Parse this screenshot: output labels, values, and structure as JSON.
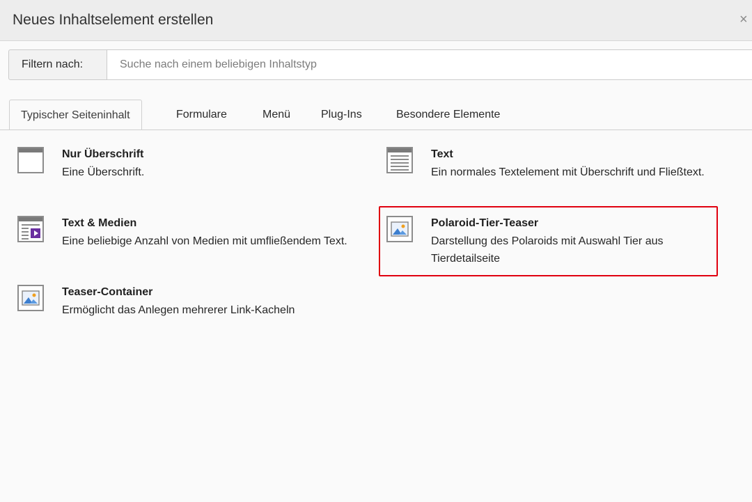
{
  "dialog": {
    "title": "Neues Inhaltselement erstellen",
    "close_symbol": "×"
  },
  "filter": {
    "label": "Filtern nach:",
    "placeholder": "Suche nach einem beliebigen Inhaltstyp",
    "value": ""
  },
  "tabs": [
    {
      "label": "Typischer Seiteninhalt",
      "active": true
    },
    {
      "label": "Formulare",
      "active": false
    },
    {
      "label": "Menü",
      "active": false
    },
    {
      "label": "Plug-Ins",
      "active": false
    },
    {
      "label": "Besondere Elemente",
      "active": false
    }
  ],
  "items": [
    {
      "title": "Nur Überschrift",
      "description": "Eine Überschrift.",
      "icon": "header-icon"
    },
    {
      "title": "Text",
      "description": "Ein normales Textelement mit Überschrift und Fließtext.",
      "icon": "text-icon"
    },
    {
      "title": "Text & Medien",
      "description": "Eine beliebige Anzahl von Medien mit umfließendem Text.",
      "icon": "text-media-icon"
    },
    {
      "title": "Polaroid-Tier-Teaser",
      "description": "Darstellung des Polaroids mit Auswahl Tier aus Tierdetailseite",
      "icon": "image-icon",
      "highlighted": true
    },
    {
      "title": "Teaser-Container",
      "description": "Ermöglicht das Anlegen mehrerer Link-Kacheln",
      "icon": "image-icon"
    }
  ],
  "colors": {
    "highlight": "#e0000f",
    "media_accent": "#6a2ea0",
    "image_sky": "#3d7fcf",
    "image_sun": "#f0a020"
  }
}
